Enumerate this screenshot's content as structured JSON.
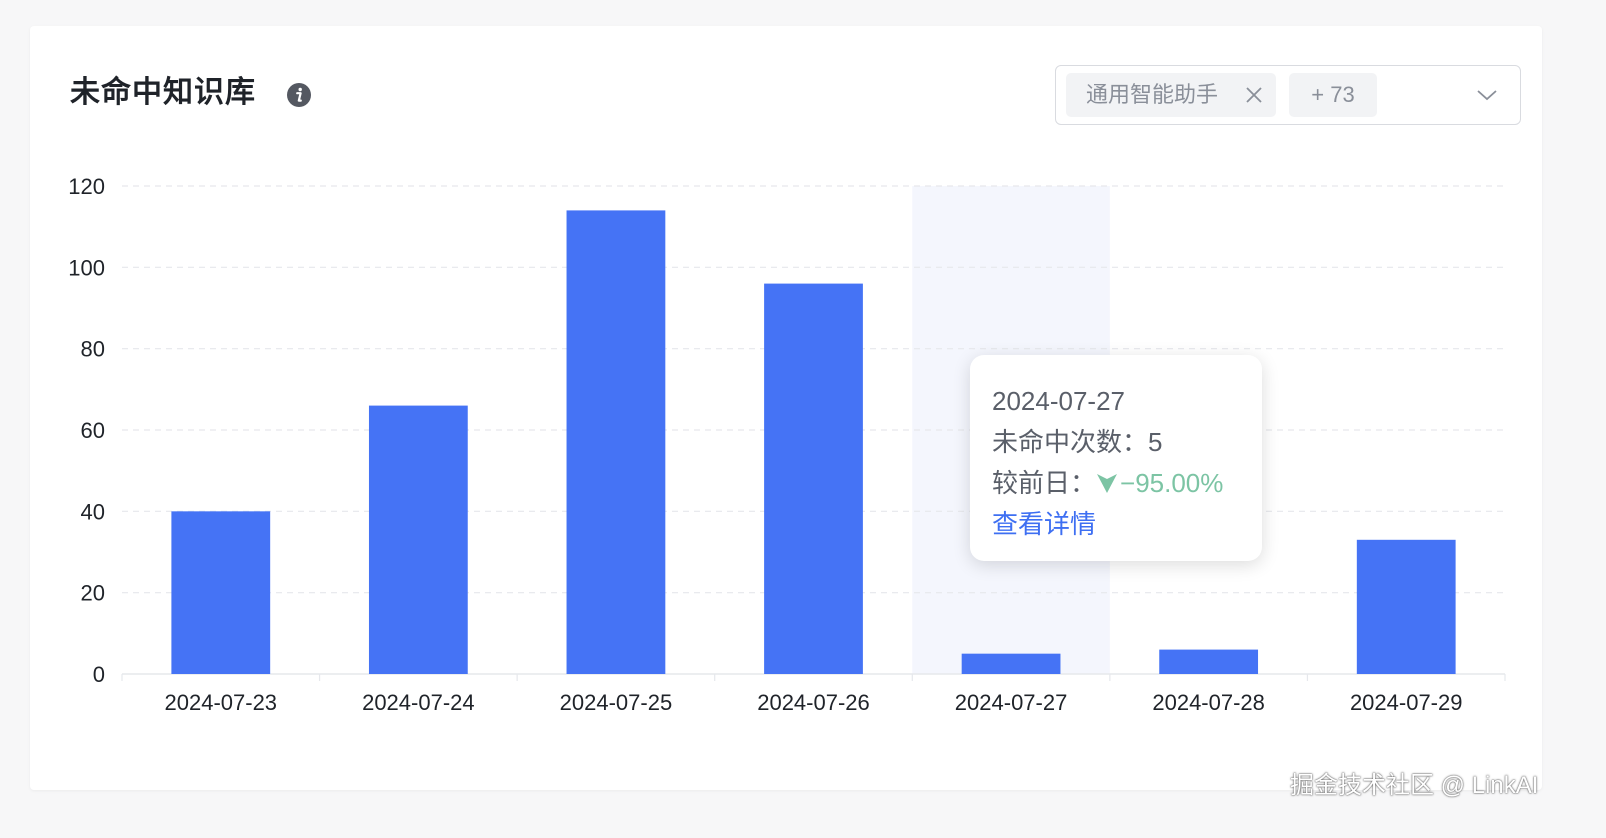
{
  "header": {
    "title": "未命中知识库"
  },
  "filter": {
    "selected_tag": "通用智能助手",
    "more_count": "+ 73"
  },
  "colors": {
    "bar": "#4573f5",
    "highlight_band": "#f4f6fd",
    "grid": "#e6e8ec",
    "axis_text": "#1f2329",
    "down": "#7cc4a4",
    "link": "#3e6ff2"
  },
  "chart_data": {
    "type": "bar",
    "categories": [
      "2024-07-23",
      "2024-07-24",
      "2024-07-25",
      "2024-07-26",
      "2024-07-27",
      "2024-07-28",
      "2024-07-29"
    ],
    "values": [
      40,
      66,
      114,
      96,
      5,
      6,
      33
    ],
    "ylim": [
      0,
      120
    ],
    "yticks": [
      "0",
      "20",
      "40",
      "60",
      "80",
      "100",
      "120"
    ],
    "grid": true,
    "highlighted_category": "2024-07-27"
  },
  "tooltip": {
    "date": "2024-07-27",
    "count_label": "未命中次数：",
    "count_value": "5",
    "compare_label": "较前日：",
    "compare_value": "−95.00%",
    "link_label": "查看详情"
  },
  "watermark": "掘金技术社区 @ LinkAI"
}
